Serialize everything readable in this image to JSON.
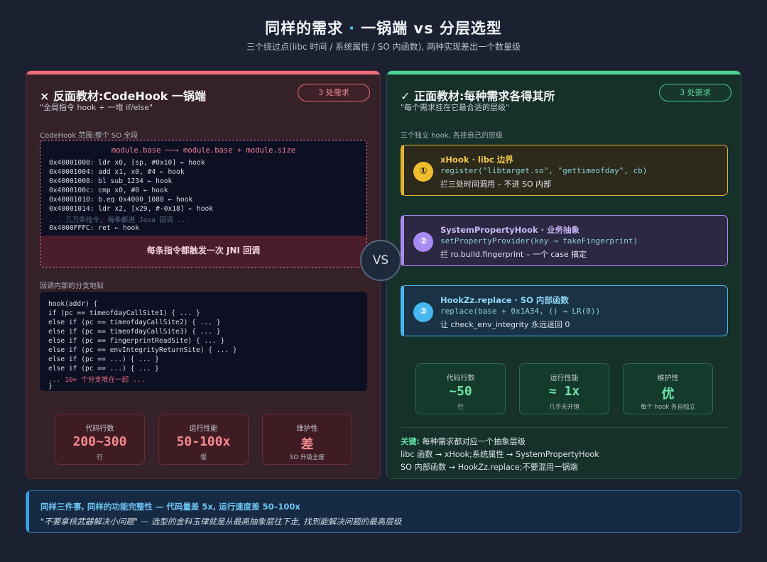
{
  "header": {
    "title_part1": "同样的需求",
    "title_dot": "·",
    "title_part2": "一锅端 vs 分层选型",
    "subtitle": "三个绕过点(libc 时间 / 系统属性 / SO 内函数), 两种实现差出一个数量级"
  },
  "left": {
    "title": "× 反面教材:CodeHook 一锅端",
    "subtitle": "\"全局指令 hook + 一堆 if/else\"",
    "badge": "3 处需求",
    "range_label": "CodeHook 范围:整个 SO 全段",
    "range_header": "module.base ──→ module.base + module.size",
    "asm_lines": [
      "0x40001000: ldr x0, [sp, #0x10] ← hook",
      "0x40001004: add x1, x0, #4 ← hook",
      "0x40001008: bl sub_1234 ← hook",
      "0x4000100c: cmp x0, #0 ← hook",
      "0x40001010: b.eq 0x4000_1080 ← hook",
      "0x40001014: ldr x2, [x29, #-0x18] ← hook",
      "... 几万条指令, 每条都进 Java 回调 ...",
      "0x4000FFFC: ret ← hook"
    ],
    "jni_bar": "每条指令都触发一次 JNI 回调",
    "branch_label": "回调内部的分支地狱",
    "branch_lines": [
      "hook(addr) {",
      "if (pc == timeofdayCallSite1) { ... }",
      "else if (pc == timeofdayCallSite2) { ... }",
      "else if (pc == timeofdayCallSite3) { ... }",
      "else if (pc == fingerprintReadSite) { ... }",
      "else if (pc == envIntegrityReturnSite) { ... }",
      "else if (pc == ...) { ... }",
      "else if (pc == ...) { ... }",
      "... 10+ 个分支堆在一起 ...",
      "}"
    ],
    "metrics": [
      {
        "label": "代码行数",
        "value": "200~300",
        "note": "行"
      },
      {
        "label": "运行性能",
        "value": "50-100x",
        "note": "慢"
      },
      {
        "label": "维护性",
        "value": "差",
        "note": "SO 升级全废"
      }
    ],
    "colors": {
      "accent": "#f06b7e",
      "bg": "#352128"
    }
  },
  "right": {
    "title": "✓ 正面教材:每种需求各得其所",
    "subtitle": "\"每个需求挂在它最合适的层级\"",
    "badge": "3 处需求",
    "section_label": "三个独立 hook, 各挂自己的层级",
    "hooks": [
      {
        "num": "①",
        "title": "xHook · libc 边界",
        "code": "register(\"libtarget.so\", \"gettimeofday\", cb)",
        "desc": "拦三处时间调用 – 不进 SO 内部",
        "color": "#e3b52f"
      },
      {
        "num": "②",
        "title": "SystemPropertyHook · 业务抽象",
        "code": "setPropertyProvider(key → fakeFingerprint)",
        "desc": "拦 ro.build.fingerprint – 一个 case 搞定",
        "color": "#a98bf0"
      },
      {
        "num": "③",
        "title": "HookZz.replace · SO 内部函数",
        "code": "replace(base + 0x1A34, () → LR(0))",
        "desc": "让 check_env_integrity 永远返回 0",
        "color": "#45b7ef"
      }
    ],
    "metrics": [
      {
        "label": "代码行数",
        "value": "~50",
        "note": "行"
      },
      {
        "label": "运行性能",
        "value": "≈ 1x",
        "note": "几乎无开销"
      },
      {
        "label": "维护性",
        "value": "优",
        "note": "每个 hook 各自独立"
      }
    ],
    "key_label": "关键:",
    "key_line1": "每种需求都对应一个抽象层级",
    "key_line2": "libc 函数 → xHook;系统属性 → SystemPropertyHook",
    "key_line3": "SO 内部函数 → HookZz.replace;不要混用一锅端",
    "colors": {
      "accent": "#4cd394",
      "bg": "#16302a"
    }
  },
  "vs": "VS",
  "bottom": {
    "line1": "同样三件事, 同样的功能完整性 — 代码量差 5x, 运行速度差 50–100x",
    "line2": "\"不要拿核武器解决小问题\" — 选型的金科玉律就是从最高抽象层往下走, 找到能解决问题的最高层级"
  }
}
